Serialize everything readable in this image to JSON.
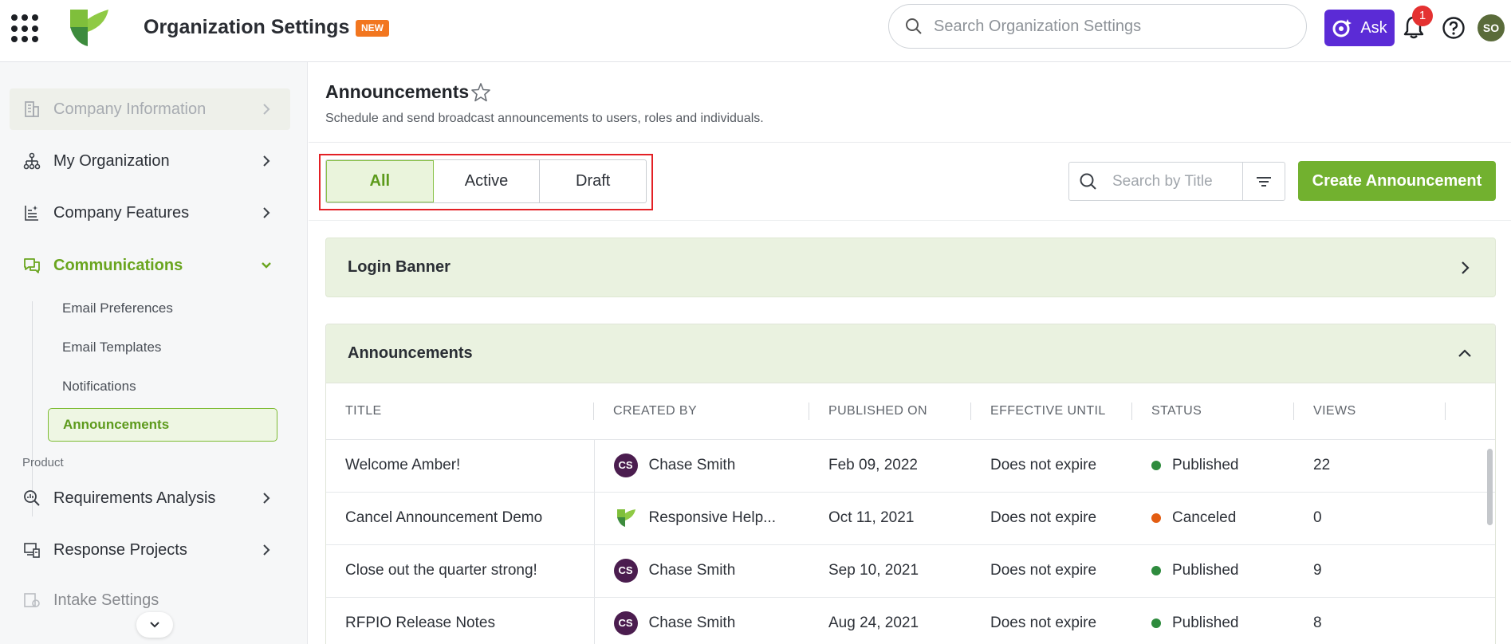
{
  "header": {
    "app_title": "Organization Settings",
    "new_badge": "NEW",
    "search_placeholder": "Search Organization Settings",
    "ask_label": "Ask",
    "notification_count": "1",
    "user_initials": "SO",
    "brand_color": "#72b12f",
    "ask_color": "#5b2bd6"
  },
  "sidebar": {
    "items": [
      {
        "label": "Company Information",
        "icon": "building-icon",
        "state": "disabled"
      },
      {
        "label": "My Organization",
        "icon": "org-chart-icon"
      },
      {
        "label": "Company Features",
        "icon": "feature-list-icon"
      },
      {
        "label": "Communications",
        "icon": "chat-bubbles-icon",
        "state": "expanded"
      }
    ],
    "sub_items": [
      {
        "label": "Email Preferences"
      },
      {
        "label": "Email Templates"
      },
      {
        "label": "Notifications"
      },
      {
        "label": "Announcements",
        "state": "active"
      }
    ],
    "section_label": "Product",
    "product_items": [
      {
        "label": "Requirements Analysis",
        "icon": "magnifier-chart-icon"
      },
      {
        "label": "Response Projects",
        "icon": "projects-icon"
      },
      {
        "label": "Intake Settings",
        "icon": "intake-icon",
        "state": "disabled"
      }
    ]
  },
  "main": {
    "title": "Announcements",
    "description": "Schedule and send broadcast announcements to users, roles and individuals.",
    "filters": [
      {
        "label": "All",
        "active": true
      },
      {
        "label": "Active",
        "active": false
      },
      {
        "label": "Draft",
        "active": false
      }
    ],
    "title_search_placeholder": "Search by Title",
    "create_button": "Create Announcement",
    "login_banner_title": "Login Banner",
    "announcements_title": "Announcements",
    "columns": [
      "TITLE",
      "CREATED BY",
      "PUBLISHED ON",
      "EFFECTIVE UNTIL",
      "STATUS",
      "VIEWS"
    ],
    "rows": [
      {
        "title": "Welcome Amber!",
        "created_by": "Chase Smith",
        "creator_initials": "CS",
        "creator_type": "user",
        "published_on": "Feb 09, 2022",
        "effective_until": "Does not expire",
        "status": "Published",
        "status_color": "#2e8b3d",
        "views": "22"
      },
      {
        "title": "Cancel Announcement Demo",
        "created_by": "Responsive Help...",
        "creator_initials": "",
        "creator_type": "system",
        "published_on": "Oct 11, 2021",
        "effective_until": "Does not expire",
        "status": "Canceled",
        "status_color": "#e35d12",
        "views": "0"
      },
      {
        "title": "Close out the quarter strong!",
        "created_by": "Chase Smith",
        "creator_initials": "CS",
        "creator_type": "user",
        "published_on": "Sep 10, 2021",
        "effective_until": "Does not expire",
        "status": "Published",
        "status_color": "#2e8b3d",
        "views": "9"
      },
      {
        "title": "RFPIO Release Notes",
        "created_by": "Chase Smith",
        "creator_initials": "CS",
        "creator_type": "user",
        "published_on": "Aug 24, 2021",
        "effective_until": "Does not expire",
        "status": "Published",
        "status_color": "#2e8b3d",
        "views": "8"
      }
    ]
  }
}
